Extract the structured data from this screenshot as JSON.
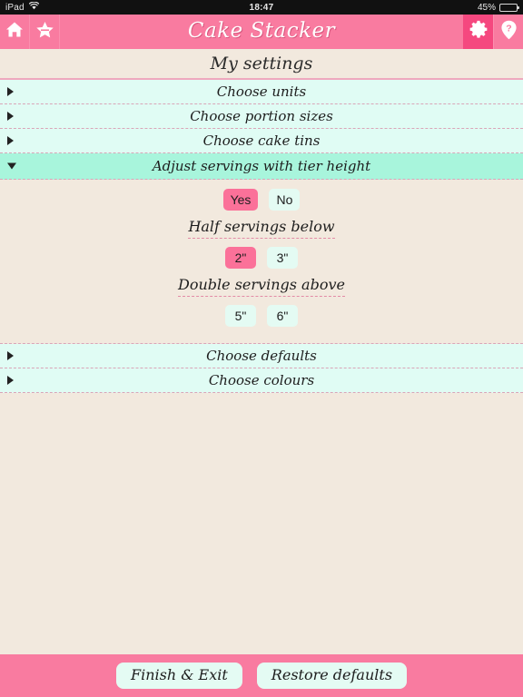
{
  "statusbar": {
    "carrier": "iPad",
    "wifi_icon": "wifi-icon",
    "time": "18:47",
    "battery_text": "45%",
    "battery_percent": 45
  },
  "toolbar": {
    "home_icon": "home-icon",
    "star_icon": "star-icon",
    "title": "Cake Stacker",
    "settings_icon": "gear-icon",
    "help_icon": "help-pin-icon",
    "bg_color": "#F97BA0",
    "accent_color": "#F5487F"
  },
  "page": {
    "title": "My settings",
    "bg_color": "#F2E9DE",
    "row_color": "#E0FCF4",
    "row_open_color": "#A8F5DC"
  },
  "sections": [
    {
      "label": "Choose units",
      "expanded": false
    },
    {
      "label": "Choose portion sizes",
      "expanded": false
    },
    {
      "label": "Choose cake tins",
      "expanded": false
    },
    {
      "label": "Adjust servings with tier height",
      "expanded": true
    },
    {
      "label": "Choose defaults",
      "expanded": false
    },
    {
      "label": "Choose colours",
      "expanded": false
    }
  ],
  "tier_height_panel": {
    "enable_options": [
      {
        "label": "Yes",
        "selected": true
      },
      {
        "label": "No",
        "selected": false
      }
    ],
    "half_servings_label": "Half servings below",
    "half_servings_options": [
      {
        "label": "2\"",
        "selected": true
      },
      {
        "label": "3\"",
        "selected": false
      }
    ],
    "double_servings_label": "Double servings above",
    "double_servings_options": [
      {
        "label": "5\"",
        "selected": false
      },
      {
        "label": "6\"",
        "selected": false
      }
    ]
  },
  "bottombar": {
    "finish_label": "Finish & Exit",
    "restore_label": "Restore defaults"
  }
}
